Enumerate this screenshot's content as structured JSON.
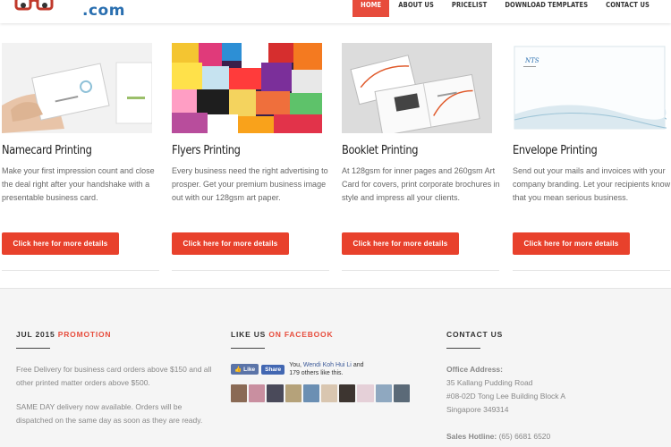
{
  "header": {
    "logo_suffix": ".com",
    "nav": [
      {
        "label": "HOME",
        "active": true
      },
      {
        "label": "ABOUT US",
        "active": false
      },
      {
        "label": "PRICELIST",
        "active": false
      },
      {
        "label": "DOWNLOAD TEMPLATES",
        "active": false
      },
      {
        "label": "CONTACT US",
        "active": false
      }
    ]
  },
  "products": [
    {
      "title": "Namecard Printing",
      "description": "Make your first impression count and close the deal right after your handshake with a presentable business card.",
      "button": "Click here for more details",
      "image_icon": "business-card-photo"
    },
    {
      "title": "Flyers Printing",
      "description": "Every business need the right advertising to prosper. Get your premium business image out with our 128gsm art paper.",
      "button": "Click here for more details",
      "image_icon": "flyers-collage-photo"
    },
    {
      "title": "Booklet Printing",
      "description": "At 128gsm for inner pages and 260gsm Art Card for covers, print corporate brochures in style and impress all your clients.",
      "button": "Click here for more details",
      "image_icon": "booklet-photo"
    },
    {
      "title": "Envelope Printing",
      "description": "Send out your mails and invoices with your company branding. Let your recipients know that you mean serious business.",
      "button": "Click here for more details",
      "image_icon": "envelope-photo"
    }
  ],
  "footer": {
    "promo": {
      "heading_prefix": "JUL 2015",
      "heading_accent": "PROMOTION",
      "p1": "Free Delivery for business card orders above $150 and all other printed matter orders above $500.",
      "p2": "SAME DAY delivery now available. Orders will be dispatched on the same day as soon as they are ready."
    },
    "facebook": {
      "heading_prefix": "LIKE US",
      "heading_accent": "ON FACEBOOK",
      "like_label": "Like",
      "share_label": "Share",
      "text_prefix": "You,",
      "text_name": "Wendi Koh Hui Li",
      "text_suffix": "and",
      "text_line2": "179 others like this."
    },
    "contact": {
      "heading": "CONTACT US",
      "address_label": "Office Address:",
      "address_lines": [
        "35 Kallang Pudding Road",
        "#08-02D Tong Lee Building Block A",
        "Singapore 349314"
      ],
      "hotline_label": "Sales Hotline:",
      "hotline_value": "(65) 6681 6520"
    }
  },
  "colors": {
    "accent": "#e74c3c",
    "logo_blue": "#2a6fb0",
    "facebook": "#3b5998"
  }
}
